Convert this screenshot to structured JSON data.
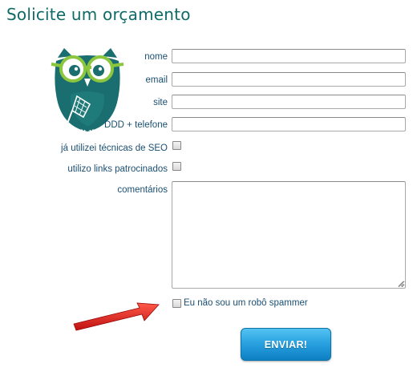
{
  "page": {
    "title": "Solicite um orçamento"
  },
  "form": {
    "fields": [
      {
        "label": "nome",
        "value": "",
        "type": "text"
      },
      {
        "label": "email",
        "value": "",
        "type": "text"
      },
      {
        "label": "site",
        "value": "",
        "type": "text"
      },
      {
        "label": "DDD + telefone",
        "value": "",
        "type": "text"
      }
    ],
    "checkboxes": [
      {
        "label": "já utilizei técnicas de SEO",
        "checked": false
      },
      {
        "label": "utilizo links patrocinados",
        "checked": false
      }
    ],
    "comments": {
      "label": "comentários",
      "value": ""
    },
    "spam_check": {
      "label": "Eu não sou um robô spammer",
      "checked": false
    },
    "submit_label": "ENVIAR!"
  },
  "colors": {
    "title": "#0f6b66",
    "label": "#1a4f72",
    "owl_body": "#1a6e70",
    "owl_glasses": "#8cc63f",
    "button": "#2aa2e0",
    "arrow": "#e02020"
  },
  "icons": {
    "mascot": "owl-mascot-icon",
    "pointer": "red-arrow-icon",
    "resize": "resize-grip-icon"
  }
}
